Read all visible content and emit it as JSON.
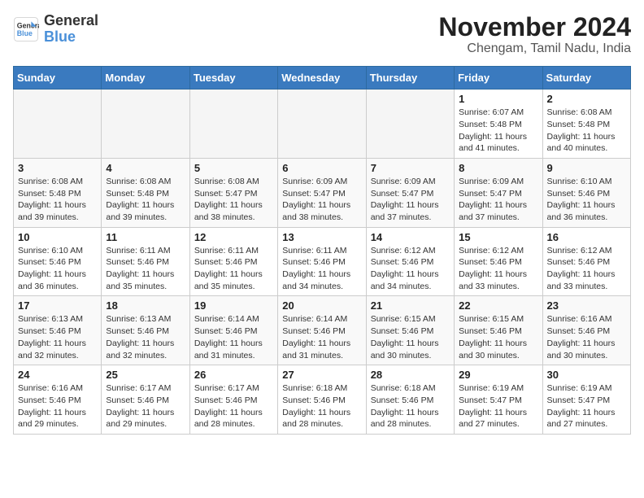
{
  "header": {
    "logo_line1": "General",
    "logo_line2": "Blue",
    "month_title": "November 2024",
    "subtitle": "Chengam, Tamil Nadu, India"
  },
  "weekdays": [
    "Sunday",
    "Monday",
    "Tuesday",
    "Wednesday",
    "Thursday",
    "Friday",
    "Saturday"
  ],
  "weeks": [
    [
      {
        "day": "",
        "info": ""
      },
      {
        "day": "",
        "info": ""
      },
      {
        "day": "",
        "info": ""
      },
      {
        "day": "",
        "info": ""
      },
      {
        "day": "",
        "info": ""
      },
      {
        "day": "1",
        "info": "Sunrise: 6:07 AM\nSunset: 5:48 PM\nDaylight: 11 hours and 41 minutes."
      },
      {
        "day": "2",
        "info": "Sunrise: 6:08 AM\nSunset: 5:48 PM\nDaylight: 11 hours and 40 minutes."
      }
    ],
    [
      {
        "day": "3",
        "info": "Sunrise: 6:08 AM\nSunset: 5:48 PM\nDaylight: 11 hours and 39 minutes."
      },
      {
        "day": "4",
        "info": "Sunrise: 6:08 AM\nSunset: 5:48 PM\nDaylight: 11 hours and 39 minutes."
      },
      {
        "day": "5",
        "info": "Sunrise: 6:08 AM\nSunset: 5:47 PM\nDaylight: 11 hours and 38 minutes."
      },
      {
        "day": "6",
        "info": "Sunrise: 6:09 AM\nSunset: 5:47 PM\nDaylight: 11 hours and 38 minutes."
      },
      {
        "day": "7",
        "info": "Sunrise: 6:09 AM\nSunset: 5:47 PM\nDaylight: 11 hours and 37 minutes."
      },
      {
        "day": "8",
        "info": "Sunrise: 6:09 AM\nSunset: 5:47 PM\nDaylight: 11 hours and 37 minutes."
      },
      {
        "day": "9",
        "info": "Sunrise: 6:10 AM\nSunset: 5:46 PM\nDaylight: 11 hours and 36 minutes."
      }
    ],
    [
      {
        "day": "10",
        "info": "Sunrise: 6:10 AM\nSunset: 5:46 PM\nDaylight: 11 hours and 36 minutes."
      },
      {
        "day": "11",
        "info": "Sunrise: 6:11 AM\nSunset: 5:46 PM\nDaylight: 11 hours and 35 minutes."
      },
      {
        "day": "12",
        "info": "Sunrise: 6:11 AM\nSunset: 5:46 PM\nDaylight: 11 hours and 35 minutes."
      },
      {
        "day": "13",
        "info": "Sunrise: 6:11 AM\nSunset: 5:46 PM\nDaylight: 11 hours and 34 minutes."
      },
      {
        "day": "14",
        "info": "Sunrise: 6:12 AM\nSunset: 5:46 PM\nDaylight: 11 hours and 34 minutes."
      },
      {
        "day": "15",
        "info": "Sunrise: 6:12 AM\nSunset: 5:46 PM\nDaylight: 11 hours and 33 minutes."
      },
      {
        "day": "16",
        "info": "Sunrise: 6:12 AM\nSunset: 5:46 PM\nDaylight: 11 hours and 33 minutes."
      }
    ],
    [
      {
        "day": "17",
        "info": "Sunrise: 6:13 AM\nSunset: 5:46 PM\nDaylight: 11 hours and 32 minutes."
      },
      {
        "day": "18",
        "info": "Sunrise: 6:13 AM\nSunset: 5:46 PM\nDaylight: 11 hours and 32 minutes."
      },
      {
        "day": "19",
        "info": "Sunrise: 6:14 AM\nSunset: 5:46 PM\nDaylight: 11 hours and 31 minutes."
      },
      {
        "day": "20",
        "info": "Sunrise: 6:14 AM\nSunset: 5:46 PM\nDaylight: 11 hours and 31 minutes."
      },
      {
        "day": "21",
        "info": "Sunrise: 6:15 AM\nSunset: 5:46 PM\nDaylight: 11 hours and 30 minutes."
      },
      {
        "day": "22",
        "info": "Sunrise: 6:15 AM\nSunset: 5:46 PM\nDaylight: 11 hours and 30 minutes."
      },
      {
        "day": "23",
        "info": "Sunrise: 6:16 AM\nSunset: 5:46 PM\nDaylight: 11 hours and 30 minutes."
      }
    ],
    [
      {
        "day": "24",
        "info": "Sunrise: 6:16 AM\nSunset: 5:46 PM\nDaylight: 11 hours and 29 minutes."
      },
      {
        "day": "25",
        "info": "Sunrise: 6:17 AM\nSunset: 5:46 PM\nDaylight: 11 hours and 29 minutes."
      },
      {
        "day": "26",
        "info": "Sunrise: 6:17 AM\nSunset: 5:46 PM\nDaylight: 11 hours and 28 minutes."
      },
      {
        "day": "27",
        "info": "Sunrise: 6:18 AM\nSunset: 5:46 PM\nDaylight: 11 hours and 28 minutes."
      },
      {
        "day": "28",
        "info": "Sunrise: 6:18 AM\nSunset: 5:46 PM\nDaylight: 11 hours and 28 minutes."
      },
      {
        "day": "29",
        "info": "Sunrise: 6:19 AM\nSunset: 5:47 PM\nDaylight: 11 hours and 27 minutes."
      },
      {
        "day": "30",
        "info": "Sunrise: 6:19 AM\nSunset: 5:47 PM\nDaylight: 11 hours and 27 minutes."
      }
    ]
  ]
}
